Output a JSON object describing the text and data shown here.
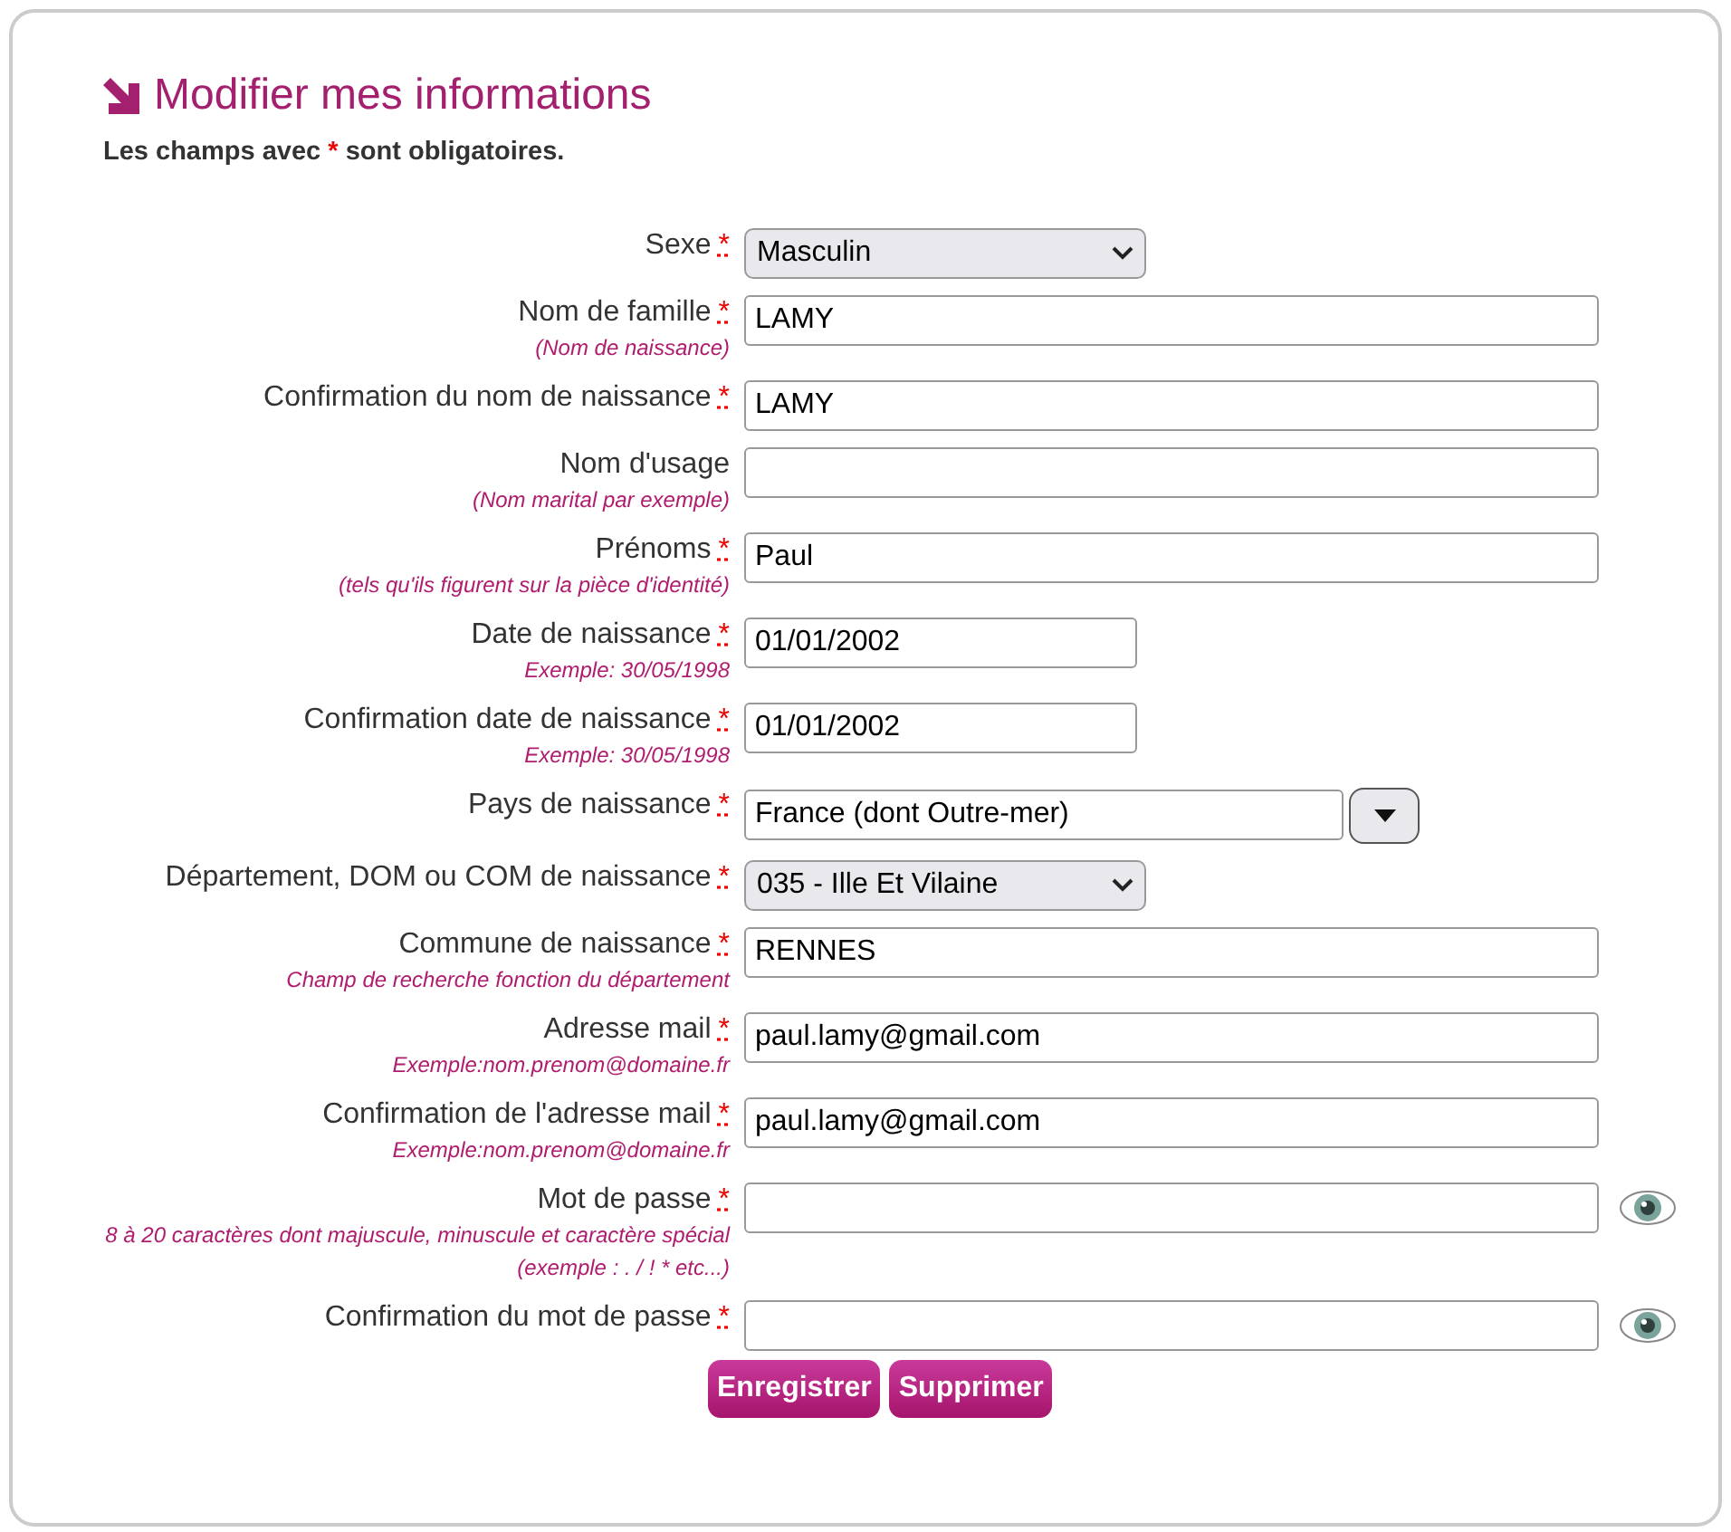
{
  "title": "Modifier mes informations",
  "notice": {
    "before": "Les champs avec",
    "mark": "*",
    "after": "sont obligatoires."
  },
  "fields": [
    {
      "kind": "select",
      "label": "Sexe",
      "required_mark": "*",
      "value": "Masculin"
    },
    {
      "kind": "text",
      "label": "Nom de famille",
      "required_mark": "*",
      "hint": "(Nom de naissance)",
      "value": "LAMY"
    },
    {
      "kind": "text",
      "label": "Confirmation du nom de naissance",
      "required_mark": "*",
      "value": "LAMY"
    },
    {
      "kind": "text",
      "label": "Nom d'usage",
      "hint": "(Nom marital par exemple)"
    },
    {
      "kind": "text",
      "label": "Prénoms",
      "required_mark": "*",
      "hint": "(tels qu'ils figurent sur la pièce d'identité)",
      "value": "Paul"
    },
    {
      "kind": "date",
      "label": "Date de naissance",
      "required_mark": "*",
      "hint": "Exemple: 30/05/1998",
      "value": "01/01/2002"
    },
    {
      "kind": "date",
      "label": "Confirmation date de naissance",
      "required_mark": "*",
      "hint": "Exemple: 30/05/1998",
      "value": "01/01/2002"
    },
    {
      "kind": "combo",
      "label": "Pays de naissance",
      "required_mark": "*",
      "value": "France (dont Outre-mer)"
    },
    {
      "kind": "select",
      "label": "Département, DOM ou COM de naissance",
      "required_mark": "*",
      "value": "035 - Ille Et Vilaine"
    },
    {
      "kind": "text",
      "label": "Commune de naissance",
      "required_mark": "*",
      "hint": "Champ de recherche fonction du département",
      "value": "RENNES"
    },
    {
      "kind": "text",
      "label": "Adresse mail",
      "required_mark": "*",
      "hint": "Exemple:nom.prenom@domaine.fr",
      "value": "paul.lamy@gmail.com"
    },
    {
      "kind": "text",
      "label": "Confirmation de l'adresse mail",
      "required_mark": "*",
      "hint": "Exemple:nom.prenom@domaine.fr",
      "value": "paul.lamy@gmail.com"
    },
    {
      "kind": "password",
      "label": "Mot de passe",
      "required_mark": "*",
      "hint": "8 à 20 caractères dont majuscule, minuscule et caractère spécial (exemple : . / ! * etc...)"
    },
    {
      "kind": "password",
      "label": "Confirmation du mot de passe",
      "required_mark": "*"
    }
  ],
  "buttons": [
    "Enregistrer",
    "Supprimer"
  ]
}
